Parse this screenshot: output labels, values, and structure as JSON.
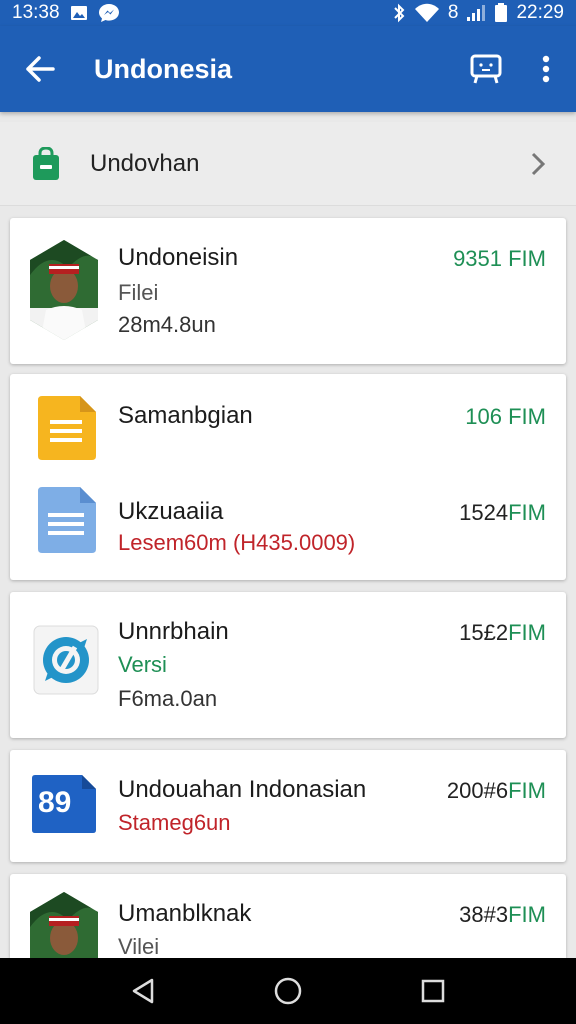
{
  "status_bar": {
    "time_left": "13:38",
    "battery_label": "8",
    "time_right": "22:29"
  },
  "app_bar": {
    "title": "Undonesia"
  },
  "category": {
    "label": "Undovhan"
  },
  "items": [
    {
      "title": "Undoneisin",
      "sub1": "Filei",
      "sub2": "28m4.8un",
      "price": "9351 FIM"
    },
    {
      "title": "Samanbgian",
      "price": "106 FIM"
    },
    {
      "title": "Ukzuaaiia",
      "sub1": "Lesem60m (H435.0009)",
      "price_num": "1524",
      "price_cur": "FIM"
    },
    {
      "title": "Unnrbhain",
      "sub1": "Versi",
      "sub2": "F6ma.0an",
      "price_num": "15£2",
      "price_cur": "FIM"
    },
    {
      "title": "Undouahan Indonasian",
      "sub1": "Stameg6un",
      "price_num": "200#6",
      "price_cur": "FIM",
      "icon_text": "89"
    },
    {
      "title": "Umanblknak",
      "sub1": "Vilei",
      "price_num": "38#3",
      "price_cur": "FIM"
    }
  ],
  "colors": {
    "primary": "#1f5fb6",
    "accent_green": "#1e8f55",
    "accent_red": "#c0242a"
  }
}
